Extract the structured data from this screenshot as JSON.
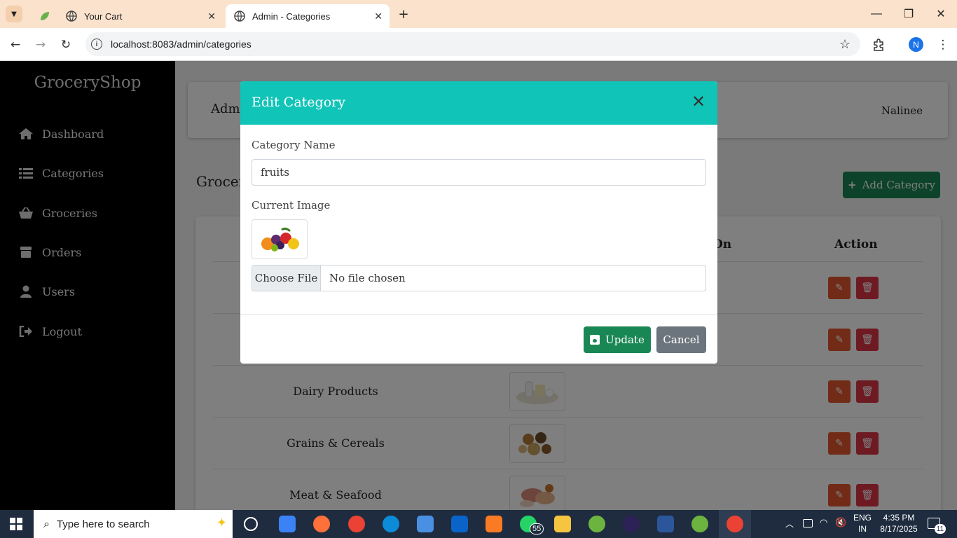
{
  "browser": {
    "tabs": [
      {
        "label": "",
        "icon": "leaf-icon"
      },
      {
        "label": "Your Cart",
        "icon": "globe-icon"
      },
      {
        "label": "Admin - Categories",
        "icon": "globe-icon"
      }
    ],
    "url": "localhost:8083/admin/categories",
    "profile_initial": "N"
  },
  "sidebar": {
    "brand": "GroceryShop",
    "items": [
      {
        "label": "Dashboard",
        "icon": "home-icon"
      },
      {
        "label": "Categories",
        "icon": "list-icon"
      },
      {
        "label": "Groceries",
        "icon": "basket-icon"
      },
      {
        "label": "Orders",
        "icon": "box-icon"
      },
      {
        "label": "Users",
        "icon": "user-icon"
      },
      {
        "label": "Logout",
        "icon": "logout-icon"
      }
    ]
  },
  "header": {
    "title": "Adm",
    "user": "Nalinee"
  },
  "content": {
    "heading": "Grocer",
    "add_button": "Add Category",
    "columns": {
      "on": "On",
      "action": "Action"
    },
    "rows": [
      {
        "name": ""
      },
      {
        "name": ""
      },
      {
        "name": "Dairy Products"
      },
      {
        "name": "Grains & Cereals"
      },
      {
        "name": "Meat & Seafood"
      }
    ]
  },
  "modal": {
    "title": "Edit Category",
    "name_label": "Category Name",
    "name_value": "fruits",
    "image_label": "Current Image",
    "file_button": "Choose File",
    "file_status": "No file chosen",
    "update_button": "Update",
    "cancel_button": "Cancel"
  },
  "taskbar": {
    "search_placeholder": "Type here to search",
    "whatsapp_badge": "55",
    "lang_line1": "ENG",
    "lang_line2": "IN",
    "time": "4:35 PM",
    "date": "8/17/2025",
    "notifications": "11"
  },
  "colors": {
    "modal_header": "#11c4b8",
    "primary_green": "#198754",
    "edit_orange": "#e4572e",
    "delete_red": "#dc3545",
    "sidebar": "#000000"
  }
}
